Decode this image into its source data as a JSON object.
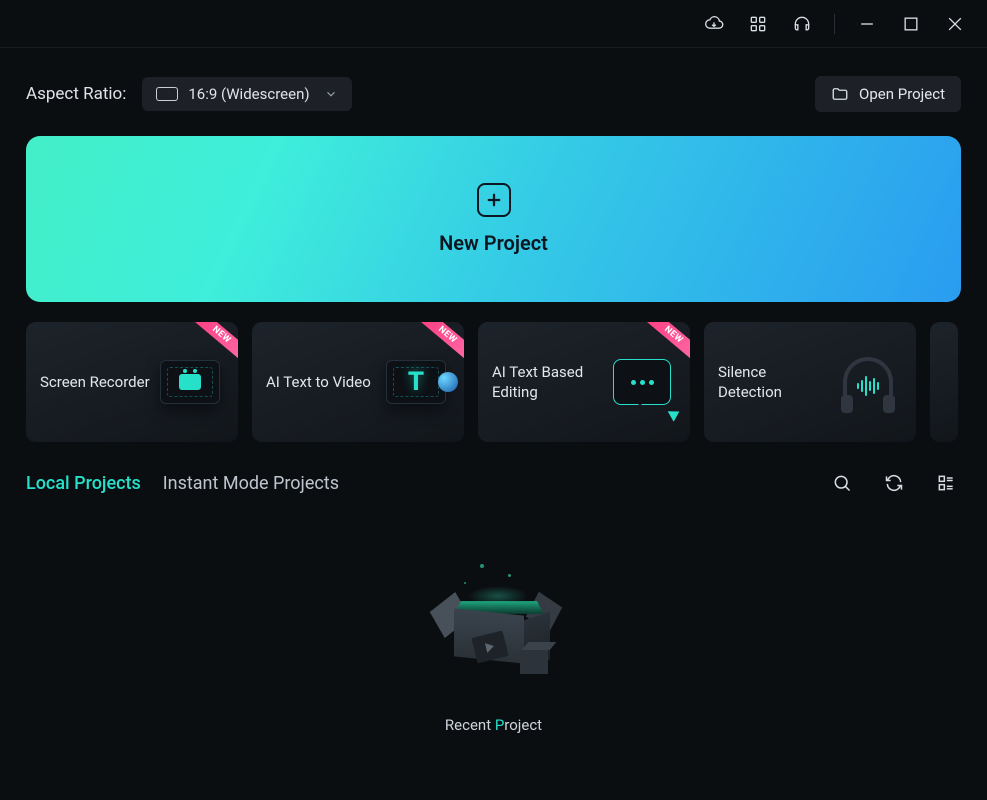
{
  "titlebar": {
    "icons": [
      "cloud-download",
      "apps-grid",
      "headset"
    ]
  },
  "aspect_ratio": {
    "label": "Aspect Ratio:",
    "selected": "16:9 (Widescreen)"
  },
  "open_project_label": "Open Project",
  "new_project_label": "New Project",
  "feature_cards": [
    {
      "title": "Screen Recorder",
      "new_badge": true
    },
    {
      "title": "AI Text to Video",
      "new_badge": true
    },
    {
      "title": "AI Text Based Editing",
      "new_badge": true
    },
    {
      "title": "Silence Detection",
      "new_badge": false
    }
  ],
  "badge_text": "NEW",
  "tabs": {
    "local": "Local Projects",
    "instant": "Instant Mode Projects",
    "active": "local"
  },
  "empty_state": {
    "label_pre": "Recent ",
    "label_hl": "P",
    "label_post": "roject"
  },
  "colors": {
    "accent": "#27e0c9",
    "bg": "#0b0e11"
  }
}
